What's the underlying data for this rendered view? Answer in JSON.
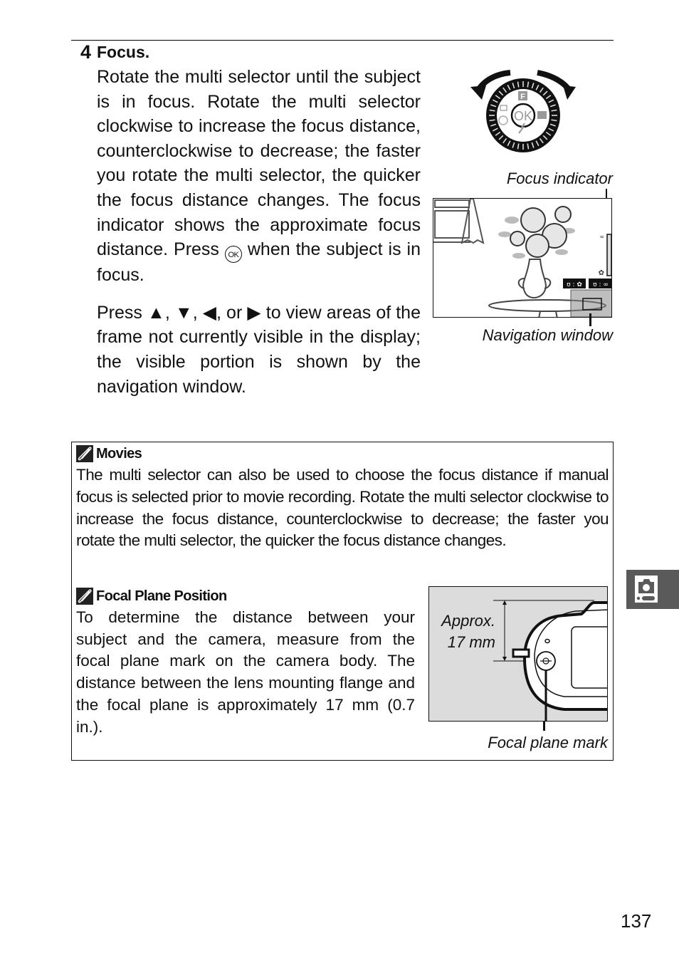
{
  "step": {
    "number": "4",
    "title": "Focus.",
    "para1_before_icon": "Rotate the multi selector until the subject is in focus. Rotate the multi selector clockwise to increase the focus distance, counterclockwise to decrease; the faster you rotate the multi selector, the quicker the focus distance changes. The focus indicator shows the approximate focus distance. Press ",
    "ok_button_glyph": "OK",
    "para1_after_icon": " when the subject is in focus.",
    "para2": "Press ▲, ▼, ◀, or ▶ to view areas of the frame not currently visible in the display; the visible portion is shown by the navigation window."
  },
  "figure_top": {
    "dial_center_label": "OK",
    "dial_top_label": "F",
    "callouts": {
      "focus_indicator": "Focus indicator",
      "navigation_window": "Navigation window"
    },
    "monitor_indicators": {
      "near": "ʊ : ✿",
      "far": "ʊ : ∞"
    }
  },
  "notes": {
    "movies": {
      "icon": "pencil-note-icon",
      "title": "Movies",
      "body": "The multi selector can also be used to choose the focus distance if manual focus is selected prior to movie recording. Rotate the multi selector clockwise to increase the focus distance, counterclockwise to decrease; the faster you rotate the multi selector, the quicker the focus distance changes."
    },
    "focal_plane": {
      "icon": "pencil-note-icon",
      "title": "Focal Plane Position",
      "body": "To determine the distance between your subject and the camera, measure from the focal plane mark on the camera body. The distance between the lens mounting flange and the focal plane is approximately 17 mm (0.7 in.).",
      "figure": {
        "approx_line1": "Approx.",
        "approx_line2": "17 mm",
        "mark_label": "Focal plane mark"
      }
    }
  },
  "side_tab": {
    "icon": "camera-shooting-icon"
  },
  "page_number": "137"
}
